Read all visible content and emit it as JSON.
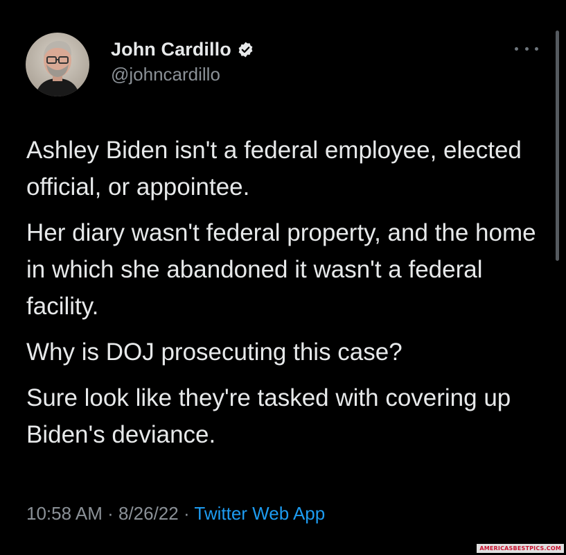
{
  "tweet": {
    "author": {
      "display_name": "John Cardillo",
      "handle": "@johncardillo",
      "verified": true,
      "verified_color": "#1d9bf0"
    },
    "more_icon": "more-horizontal-icon",
    "paragraphs": [
      "Ashley Biden isn't a federal employee, elected official, or appointee.",
      "Her diary wasn't federal property, and the home in which she abandoned it wasn't a federal facility.",
      "Why is DOJ prosecuting this case?",
      "Sure look like they're tasked with covering up Biden's deviance."
    ],
    "time": "10:58 AM",
    "date": "8/26/22",
    "separator": "·",
    "source": "Twitter Web App"
  },
  "watermark": {
    "text": "AMERICASBESTPICS.COM"
  },
  "colors": {
    "background": "#000000",
    "text": "#e7e9ea",
    "secondary": "#8b9197",
    "link": "#1d9bf0"
  }
}
